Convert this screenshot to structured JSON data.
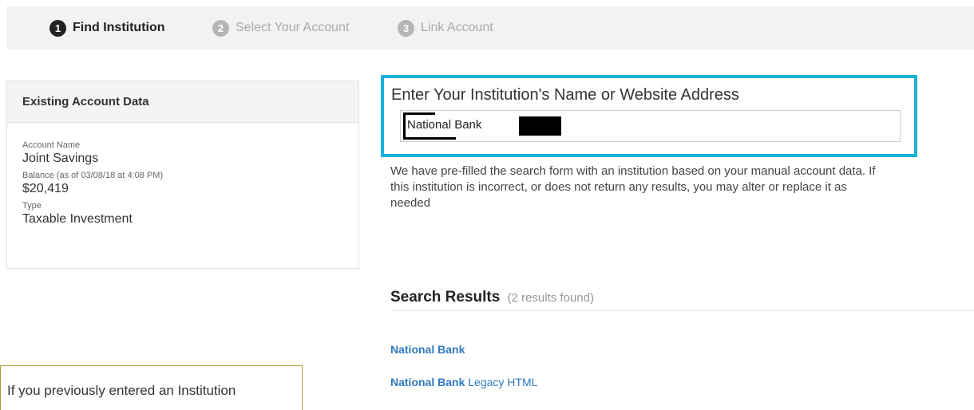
{
  "steps": [
    {
      "number": "1",
      "label": "Find Institution",
      "state": "active"
    },
    {
      "number": "2",
      "label": "Select Your Account",
      "state": "inactive"
    },
    {
      "number": "3",
      "label": "Link Account",
      "state": "inactive"
    }
  ],
  "existing_account": {
    "header": "Existing Account Data",
    "account_name_label": "Account Name",
    "account_name": "Joint Savings",
    "balance_label": "Balance (as of 03/08/18 at 4:08 PM)",
    "balance": "$20,419",
    "type_label": "Type",
    "type": "Taxable Investment"
  },
  "search": {
    "title": "Enter Your Institution's Name or Website Address",
    "value": "National Bank",
    "hint": "We have pre-filled the search form with an institution based on your manual account data. If this institution is incorrect, or does not return any results, you may alter or replace it as needed"
  },
  "results": {
    "title": "Search Results",
    "count": "(2 results found)",
    "items": [
      {
        "name": "National Bank",
        "suffix": ""
      },
      {
        "name": "National Bank",
        "suffix": " Legacy HTML"
      }
    ]
  },
  "callout": {
    "text": "If you previously entered an Institution"
  },
  "colors": {
    "highlight_border": "#1ab0dc",
    "link": "#2e79c0",
    "callout_border": "#b59b2d"
  }
}
